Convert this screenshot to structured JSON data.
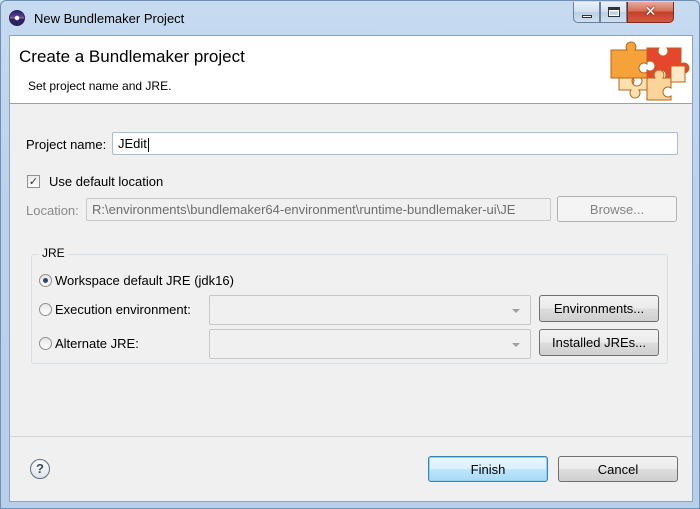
{
  "window": {
    "title": "New Bundlemaker Project"
  },
  "banner": {
    "title": "Create a Bundlemaker project",
    "description": "Set project name and JRE."
  },
  "project_name": {
    "label": "Project name:",
    "value": "JEdit"
  },
  "default_location": {
    "label": "Use default location",
    "checked": true
  },
  "location": {
    "label": "Location:",
    "value": "R:\\environments\\bundlemaker64-environment\\runtime-bundlemaker-ui\\JE",
    "browse_label": "Browse..."
  },
  "jre": {
    "group_title": "JRE",
    "workspace_default": {
      "label": "Workspace default JRE (jdk16)",
      "selected": true
    },
    "execution_environment": {
      "label": "Execution environment:",
      "selected": false,
      "button": "Environments..."
    },
    "alternate": {
      "label": "Alternate JRE:",
      "selected": false,
      "button": "Installed JREs..."
    }
  },
  "footer": {
    "finish_label": "Finish",
    "cancel_label": "Cancel",
    "help_symbol": "?"
  },
  "icons": {
    "app": "eclipse-icon",
    "banner": "puzzle-pieces-icon",
    "help": "help-icon"
  }
}
